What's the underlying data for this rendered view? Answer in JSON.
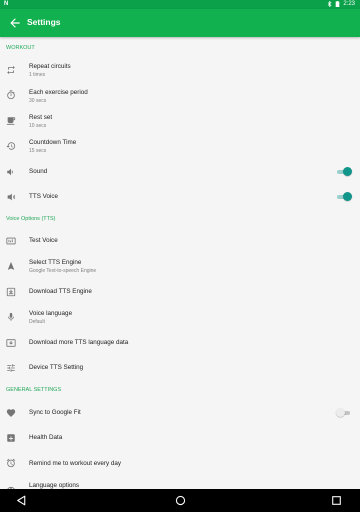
{
  "status_bar": {
    "time": "2:23"
  },
  "app_bar": {
    "title": "Settings"
  },
  "sections": {
    "workout": "WORKOUT",
    "voice": "Voice Options (TTS)",
    "general": "GENERAL SETTINGS"
  },
  "items": {
    "repeat_circuits": {
      "title": "Repeat circuits",
      "summary": "1 times"
    },
    "exercise_period": {
      "title": "Each exercise period",
      "summary": "30 secs"
    },
    "rest_set": {
      "title": "Rest set",
      "summary": "10 secs"
    },
    "countdown": {
      "title": "Countdown Time",
      "summary": "15 secs"
    },
    "sound": {
      "title": "Sound",
      "on": true
    },
    "tts_voice": {
      "title": "TTS Voice",
      "on": true
    },
    "test_voice": {
      "title": "Test Voice"
    },
    "tts_engine": {
      "title": "Select TTS Engine",
      "summary": "Google Text-to-speech Engine"
    },
    "download_engine": {
      "title": "Download TTS Engine"
    },
    "voice_language": {
      "title": "Voice language",
      "summary": "Default"
    },
    "download_data": {
      "title": "Download more TTS language data"
    },
    "device_tts": {
      "title": "Device TTS Setting"
    },
    "google_fit": {
      "title": "Sync to Google Fit",
      "on": false
    },
    "health_data": {
      "title": "Health Data"
    },
    "remind": {
      "title": "Remind me to workout every day"
    },
    "language": {
      "title": "Language options"
    }
  },
  "colors": {
    "app_bar": "#12b14f",
    "status_bar": "#0aa14a",
    "accent_header": "#24a85a",
    "switch_on": "#10958a"
  }
}
